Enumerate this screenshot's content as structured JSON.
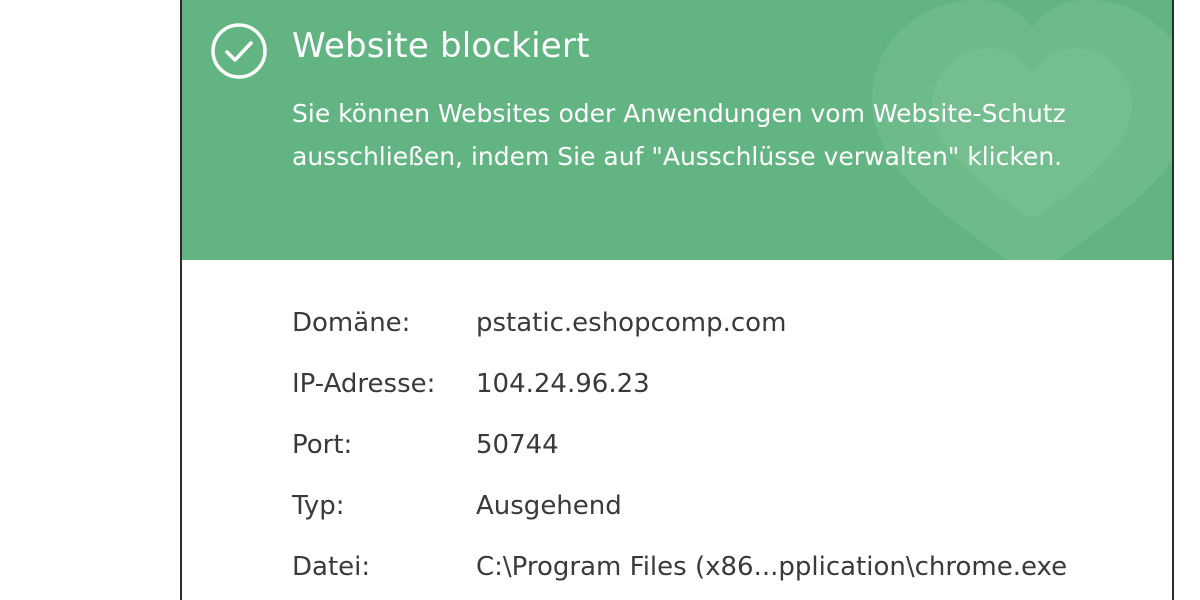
{
  "banner": {
    "icon": "check-circle-icon",
    "background_color": "#62b582",
    "title": "Website blockiert",
    "description": "Sie können Websites oder Anwendungen vom Website-Schutz ausschließen, indem Sie auf \"Ausschlüsse verwalten\" klicken."
  },
  "details": [
    {
      "label": "Domäne:",
      "value": "pstatic.eshopcomp.com"
    },
    {
      "label": "IP-Adresse:",
      "value": "104.24.96.23"
    },
    {
      "label": "Port:",
      "value": "50744"
    },
    {
      "label": "Typ:",
      "value": "Ausgehend"
    },
    {
      "label": "Datei:",
      "value": "C:\\Program Files (x86...pplication\\chrome.exe"
    }
  ]
}
